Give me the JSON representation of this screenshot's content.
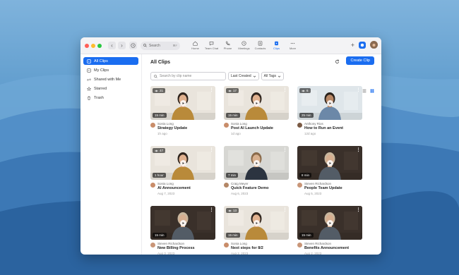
{
  "window": {
    "search_label": "Search",
    "search_shortcut": "⌘F"
  },
  "top_nav": [
    {
      "label": "Home",
      "icon": "home-icon"
    },
    {
      "label": "Team Chat",
      "icon": "chat-icon"
    },
    {
      "label": "Phone",
      "icon": "phone-icon"
    },
    {
      "label": "Meetings",
      "icon": "clock-icon"
    },
    {
      "label": "Contacts",
      "icon": "contacts-icon"
    },
    {
      "label": "Clips",
      "icon": "clips-icon",
      "active": true
    },
    {
      "label": "More",
      "icon": "more-icon"
    }
  ],
  "sidebar": {
    "items": [
      {
        "label": "All Clips",
        "icon": "clips-icon",
        "active": true
      },
      {
        "label": "My Clips",
        "icon": "folder-icon"
      },
      {
        "label": "Shared with Me",
        "icon": "share-icon"
      },
      {
        "label": "Starred",
        "icon": "star-icon"
      },
      {
        "label": "Trash",
        "icon": "trash-icon"
      }
    ]
  },
  "main": {
    "title": "All Clips",
    "create_label": "Create Clip",
    "search_placeholder": "Search by clip name",
    "sort_label": "Last Created",
    "tags_label": "All Tags"
  },
  "clips": [
    {
      "views": "21",
      "duration": "15 min",
      "author": "Sonia Long",
      "title": "Strategy Update",
      "date": "1h ago"
    },
    {
      "views": "17",
      "duration": "15 min",
      "author": "Sonia Long",
      "title": "Post AI Launch Update",
      "date": "1d ago"
    },
    {
      "views": "6",
      "duration": "25 min",
      "author": "Anthony Rios",
      "title": "How to Run an Event",
      "date": "12d ago"
    },
    {
      "views": "47",
      "duration": "1 hour",
      "author": "Sonia Long",
      "title": "AI Announcement",
      "date": "Aug 7, 2023"
    },
    {
      "views": "",
      "duration": "7 min",
      "author": "Craig Meyer",
      "title": "Quick Feature Demo",
      "date": "Aug 6, 2023"
    },
    {
      "views": "",
      "duration": "8 min",
      "author": "Steven Richardson",
      "title": "People Team Update",
      "date": "Aug 5, 2023"
    },
    {
      "views": "",
      "duration": "15 min",
      "author": "Steven Richardson",
      "title": "New Billing Process",
      "date": "Aug 3, 2023"
    },
    {
      "views": "13",
      "duration": "15 min",
      "author": "Sonia Long",
      "title": "Next steps for 8/2",
      "date": "Aug 2, 2023"
    },
    {
      "views": "",
      "duration": "15 min",
      "author": "Steven Richardson",
      "title": "Benefits Announcement",
      "date": "Aug 2, 2023"
    }
  ],
  "colors": {
    "accent": "#1a6df0",
    "desktop_bg": "#5f9ccd"
  }
}
